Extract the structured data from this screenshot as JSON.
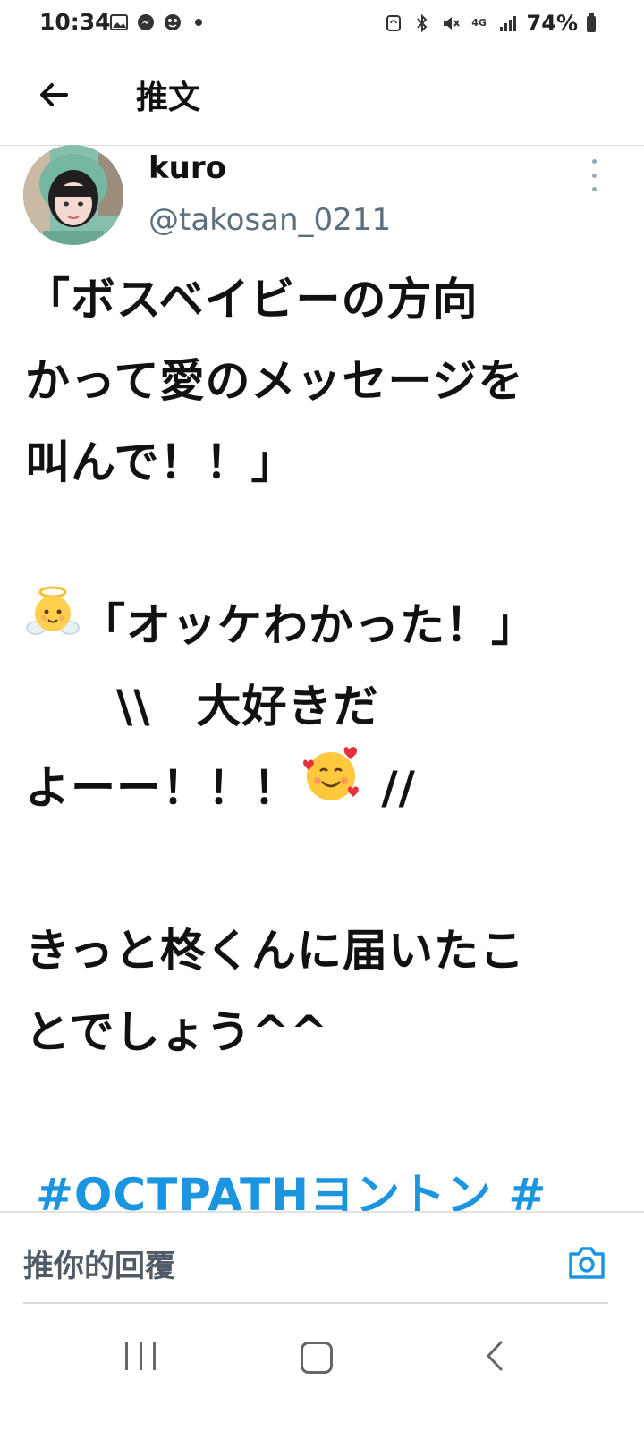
{
  "status_bar": {
    "time": "10:34",
    "network": "4G",
    "battery": "74%",
    "left_icons": [
      "gallery-icon",
      "messenger-icon",
      "app-notification-icon",
      "dot-icon"
    ],
    "right_icons": [
      "sync-icon",
      "bluetooth-icon",
      "mute-icon",
      "network-4g-icon",
      "signal-icon",
      "battery-icon"
    ]
  },
  "header": {
    "title": "推文",
    "back_icon": "arrow-left-icon"
  },
  "tweet": {
    "display_name": "kuro",
    "handle": "@takosan_0211",
    "more_icon": "more-vertical-icon",
    "lines": [
      "「ボスベイビーの方向",
      "かって愛のメッセージを",
      "叫んで！！」",
      "",
      "「オッケわかった！」",
      "　　\\\\　大好きだ",
      "よーー！！！",
      "",
      "きっと柊くんに届いたこ",
      "とでしょう^^",
      "",
      "#OCTPATHヨントン #"
    ],
    "emoji_angel": "baby-angel-emoji",
    "emoji_hearts": "smiling-face-with-hearts-emoji",
    "after_hearts": " //",
    "hashtag_color": "#1b95e0"
  },
  "reply": {
    "placeholder": "推你的回覆",
    "camera_icon": "camera-icon",
    "accent": "#1b95e0"
  },
  "navbar": {
    "recents_icon": "recents-icon",
    "home_icon": "home-icon",
    "back_icon": "back-chevron-icon"
  }
}
